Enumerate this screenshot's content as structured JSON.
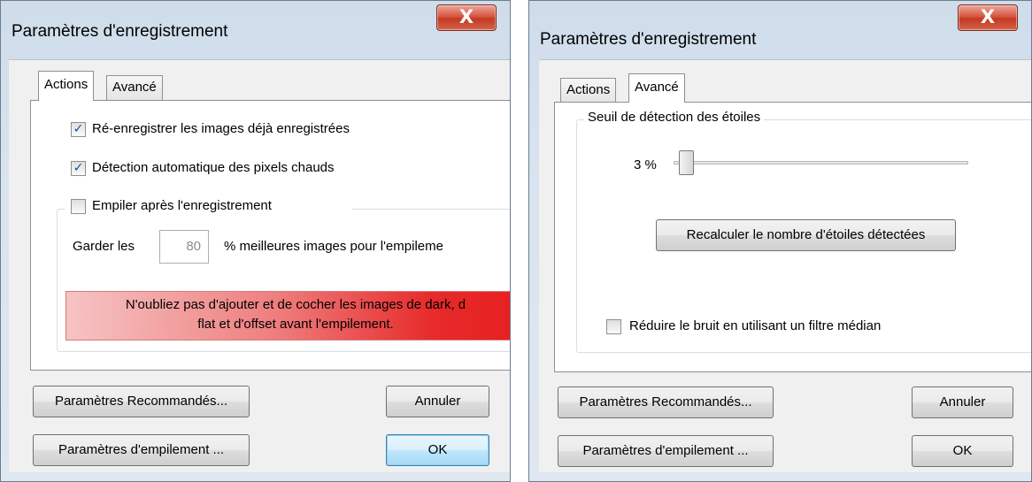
{
  "left_dialog": {
    "title": "Paramètres d'enregistrement",
    "close_glyph": "X",
    "tabs": [
      {
        "label": "Actions",
        "active": true
      },
      {
        "label": "Avancé",
        "active": false
      }
    ],
    "options": [
      {
        "label": "Ré-enregistrer les images déjà enregistrées",
        "checked": true
      },
      {
        "label": "Détection automatique des pixels chauds",
        "checked": true
      }
    ],
    "stack_group": {
      "label": "Empiler après l'enregistrement",
      "checked": false,
      "keep_prefix": "Garder les",
      "keep_value": "80",
      "keep_suffix": "% meilleures images pour l'empileme",
      "warning_line1": "N'oubliez pas d'ajouter et de cocher les images de dark, d",
      "warning_line2": "flat et d'offset avant l'empilement."
    },
    "buttons": {
      "recommended": "Paramètres Recommandés...",
      "cancel": "Annuler",
      "stacking": "Paramètres d'empilement ...",
      "ok": "OK"
    }
  },
  "right_dialog": {
    "title": "Paramètres d'enregistrement",
    "close_glyph": "X",
    "tabs": [
      {
        "label": "Actions",
        "active": false
      },
      {
        "label": "Avancé",
        "active": true
      }
    ],
    "star_group": {
      "label": "Seuil de détection des étoiles",
      "threshold_text": "3 %",
      "threshold_value_percent": 3,
      "recalc_button": "Recalculer le nombre d'étoiles détectées"
    },
    "median_filter": {
      "label": "Réduire le bruit en utilisant un filtre médian",
      "checked": false
    },
    "buttons": {
      "recommended": "Paramètres Recommandés...",
      "cancel": "Annuler",
      "stacking": "Paramètres d'empilement ...",
      "ok": "OK"
    }
  },
  "icons": {
    "check": "✓",
    "close": "close-x-icon"
  },
  "colors": {
    "close_button": "#c9442c",
    "warning_red": "#e72a2a",
    "checkbox_tick": "#1a4a9c"
  }
}
